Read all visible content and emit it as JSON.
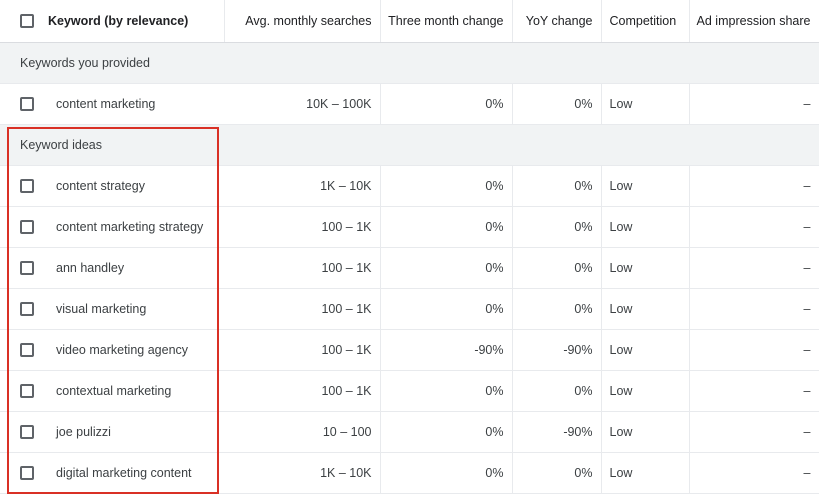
{
  "header": {
    "keyword": "Keyword (by relevance)",
    "searches": "Avg. monthly searches",
    "three_month": "Three month change",
    "yoy": "YoY change",
    "competition": "Competition",
    "impression_share": "Ad impression share"
  },
  "sections": {
    "provided": "Keywords you provided",
    "ideas": "Keyword ideas"
  },
  "provided_rows": [
    {
      "keyword": "content marketing",
      "searches": "10K – 100K",
      "three_month": "0%",
      "yoy": "0%",
      "competition": "Low",
      "impression_share": "–"
    }
  ],
  "idea_rows": [
    {
      "keyword": "content strategy",
      "searches": "1K – 10K",
      "three_month": "0%",
      "yoy": "0%",
      "competition": "Low",
      "impression_share": "–"
    },
    {
      "keyword": "content marketing strategy",
      "searches": "100 – 1K",
      "three_month": "0%",
      "yoy": "0%",
      "competition": "Low",
      "impression_share": "–"
    },
    {
      "keyword": "ann handley",
      "searches": "100 – 1K",
      "three_month": "0%",
      "yoy": "0%",
      "competition": "Low",
      "impression_share": "–"
    },
    {
      "keyword": "visual marketing",
      "searches": "100 – 1K",
      "three_month": "0%",
      "yoy": "0%",
      "competition": "Low",
      "impression_share": "–"
    },
    {
      "keyword": "video marketing agency",
      "searches": "100 – 1K",
      "three_month": "-90%",
      "yoy": "-90%",
      "competition": "Low",
      "impression_share": "–"
    },
    {
      "keyword": "contextual marketing",
      "searches": "100 – 1K",
      "three_month": "0%",
      "yoy": "0%",
      "competition": "Low",
      "impression_share": "–"
    },
    {
      "keyword": "joe pulizzi",
      "searches": "10 – 100",
      "three_month": "0%",
      "yoy": "-90%",
      "competition": "Low",
      "impression_share": "–"
    },
    {
      "keyword": "digital marketing content",
      "searches": "1K – 10K",
      "three_month": "0%",
      "yoy": "0%",
      "competition": "Low",
      "impression_share": "–"
    }
  ],
  "colors": {
    "highlight": "#d93025",
    "section_bg": "#f1f3f4"
  }
}
